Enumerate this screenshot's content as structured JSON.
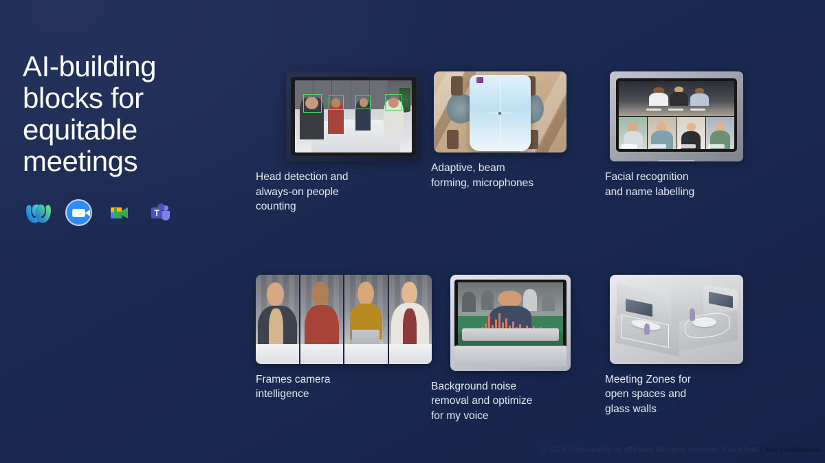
{
  "slide": {
    "background_color": "#1b2a52",
    "title": "AI-building\nblocks for\nequitable\nmeetings"
  },
  "platform_logos": [
    {
      "name": "webex-logo",
      "label": "Webex"
    },
    {
      "name": "zoom-logo",
      "label": "Zoom"
    },
    {
      "name": "google-meet-logo",
      "label": "Google Meet"
    },
    {
      "name": "microsoft-teams-logo",
      "label": "Microsoft Teams"
    }
  ],
  "cards": [
    {
      "id": "head-detection",
      "caption": "Head detection and\nalways-on people\ncounting",
      "image_alt": "Conference room video screen with green head-detection boxes around four seated participants",
      "detection_box_color": "#49e060"
    },
    {
      "id": "adaptive-beam-forming",
      "caption": "Adaptive, beam\nforming, microphones",
      "image_alt": "Overhead view of a meeting room table with chairs and microphone beam crosshair"
    },
    {
      "id": "facial-recognition",
      "caption": "Facial recognition\nand name labelling",
      "image_alt": "Collaboration board device showing a video grid of participants with name labels"
    },
    {
      "id": "frames-camera",
      "caption": "Frames camera\nintelligence",
      "image_alt": "Four meeting participants each shown in their own individual camera frame"
    },
    {
      "id": "background-noise-removal",
      "caption": "Background noise\nremoval and optimize\nfor my voice",
      "image_alt": "Desk device showing a man speaking with a red audio waveform overlay in a busy open office",
      "waveform_color": "#e8705e"
    },
    {
      "id": "meeting-zones",
      "caption": "Meeting Zones for\nopen spaces and\nglass walls",
      "image_alt": "Grey 3D isometric render of two adjacent meeting rooms with highlighted floor zones"
    }
  ],
  "footer": {
    "copyright": "© 2024 Cisco and/or its affiliates. All rights reserved. Cisco Public",
    "classification": "Cisco Confidential"
  }
}
